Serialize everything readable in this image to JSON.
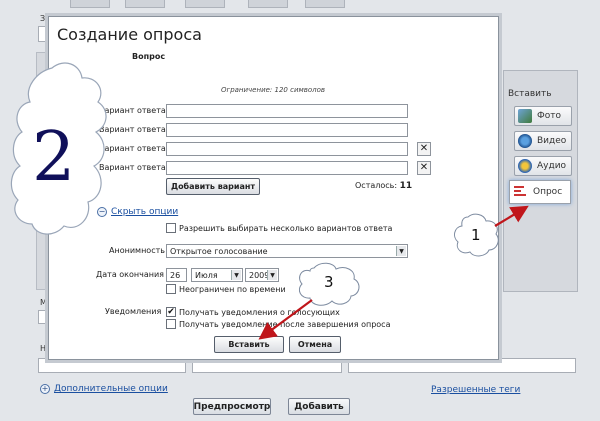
{
  "background": {
    "label_top": "За",
    "label_mid": "М",
    "label_low": "На",
    "more_options_link": "Дополнительные опции",
    "allowed_tags_link": "Разрешенные теги",
    "preview_button": "Предпросмотр",
    "add_button": "Добавить"
  },
  "insert_panel": {
    "title": "Вставить",
    "items": [
      {
        "label": "Фото",
        "icon": "photo-icon"
      },
      {
        "label": "Видео",
        "icon": "video-icon"
      },
      {
        "label": "Аудио",
        "icon": "audio-icon"
      },
      {
        "label": "Опрос",
        "icon": "poll-icon"
      }
    ]
  },
  "dialog": {
    "title": "Создание опроса",
    "question_label": "Вопрос",
    "limit_note": "Ограничение: 120 символов",
    "answers": [
      {
        "label": "Вариант ответа",
        "value": "",
        "removable": false
      },
      {
        "label": "Вариант ответа",
        "value": "",
        "removable": false
      },
      {
        "label": "Вариант ответа",
        "value": "",
        "removable": true
      },
      {
        "label": "Вариант ответа",
        "value": "",
        "removable": true
      }
    ],
    "remove_glyph": "✕",
    "add_variant_button": "Добавить вариант",
    "remaining_label": "Осталось:",
    "remaining_count": "11",
    "hide_options_link": "Скрыть опции",
    "allow_multiple_label": "Разрешить выбирать несколько вариантов ответа",
    "allow_multiple_checked": false,
    "anonymity_label": "Анонимность",
    "anonymity_value": "Открытое голосование",
    "end_date_label": "Дата окончания",
    "end_day": "26",
    "end_month": "Июля",
    "end_year": "2009",
    "unlimited_label": "Неограничен по времени",
    "unlimited_checked": false,
    "notifications_label": "Уведомления",
    "notify_each_label": "Получать уведомления о голосующих",
    "notify_each_checked": true,
    "notify_end_label": "Получать уведомление после завершения опроса",
    "notify_end_checked": false,
    "insert_button": "Вставить",
    "cancel_button": "Отмена"
  },
  "annotations": {
    "step_1": "1",
    "step_2": "2",
    "step_3": "3",
    "arrow_color": "#c0161b"
  }
}
